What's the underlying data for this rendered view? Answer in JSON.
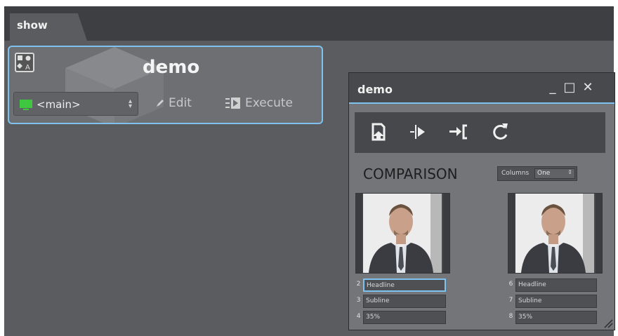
{
  "tab": {
    "label": "show"
  },
  "template_card": {
    "title": "demo",
    "channel_value": "<main>",
    "edit_label": "Edit",
    "execute_label": "Execute"
  },
  "window": {
    "title": "demo",
    "controls": {
      "minimize": "_",
      "maximize": "□",
      "close": "✕"
    },
    "toolbar_icons": [
      "page-arrow-icon",
      "step-forward-icon",
      "jump-to-bracket-icon",
      "refresh-icon"
    ],
    "comparison_label": "COMPARISON",
    "columns": {
      "label": "Columns",
      "value": "One"
    },
    "left_panel": {
      "fields": [
        {
          "num": "2",
          "value": "Headline"
        },
        {
          "num": "3",
          "value": "Subline"
        },
        {
          "num": "4",
          "value": "35%"
        }
      ]
    },
    "right_panel": {
      "fields": [
        {
          "num": "6",
          "value": "Headline"
        },
        {
          "num": "7",
          "value": "Subline"
        },
        {
          "num": "8",
          "value": "35%"
        }
      ]
    }
  },
  "colors": {
    "accent": "#7ec3f0",
    "background": "#5a5c5f",
    "monitor_green": "#3fc83f"
  }
}
